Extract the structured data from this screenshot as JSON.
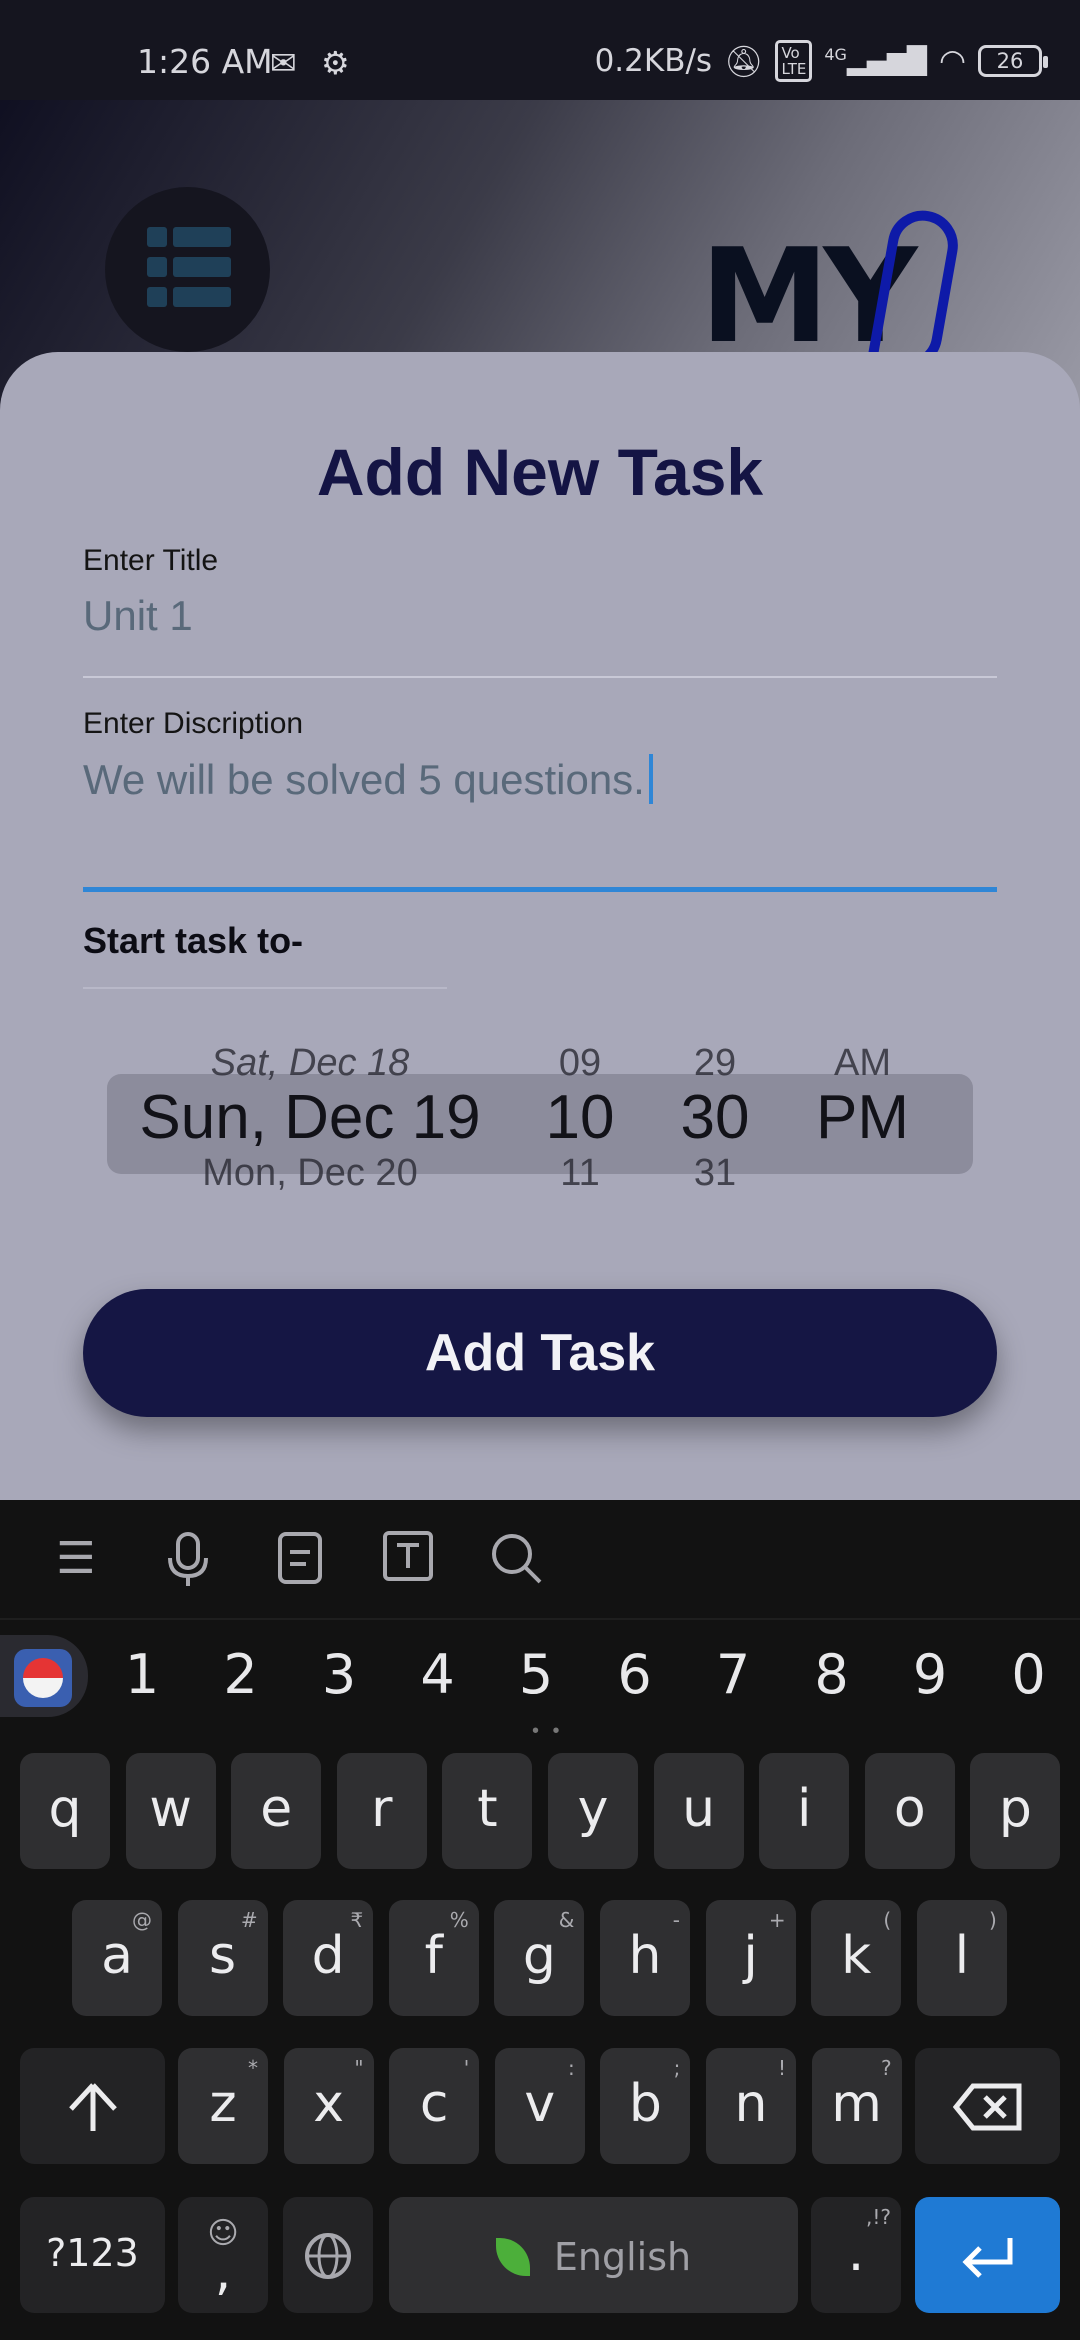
{
  "status_bar": {
    "time": "1:26 AM",
    "left_icons": [
      "gmail-icon",
      "gear-icon"
    ],
    "network_speed": "0.2KB/s",
    "volte_label": "Vo LTE",
    "network_type": "4G",
    "battery": "26"
  },
  "sheet": {
    "title": "Add New Task",
    "title_field": {
      "label": "Enter Title",
      "value": "Unit 1"
    },
    "description_field": {
      "label": "Enter Discription",
      "value": "We will be solved 5 questions."
    },
    "start_label": "Start task to-",
    "picker": {
      "date": {
        "prev": "Sat, Dec 18",
        "selected": "Sun, Dec 19",
        "next": "Mon, Dec 20"
      },
      "hour": {
        "prev": "09",
        "selected": "10",
        "next": "11"
      },
      "minute": {
        "prev": "29",
        "selected": "30",
        "next": "31"
      },
      "ampm": {
        "prev": "AM",
        "selected": "PM"
      }
    },
    "add_button": "Add Task"
  },
  "keyboard": {
    "toolbar": [
      "menu-icon",
      "microphone-icon",
      "clipboard-icon",
      "text-edit-icon",
      "search-icon"
    ],
    "numbers": [
      "1",
      "2",
      "3",
      "4",
      "5",
      "6",
      "7",
      "8",
      "9",
      "0"
    ],
    "row1": [
      "q",
      "w",
      "e",
      "r",
      "t",
      "y",
      "u",
      "i",
      "o",
      "p"
    ],
    "row2": [
      {
        "k": "a",
        "s": "@"
      },
      {
        "k": "s",
        "s": "#"
      },
      {
        "k": "d",
        "s": "₹"
      },
      {
        "k": "f",
        "s": "%"
      },
      {
        "k": "g",
        "s": "&"
      },
      {
        "k": "h",
        "s": "-"
      },
      {
        "k": "j",
        "s": "+"
      },
      {
        "k": "k",
        "s": "("
      },
      {
        "k": "l",
        "s": ")"
      }
    ],
    "row3": [
      {
        "k": "z",
        "s": "*"
      },
      {
        "k": "x",
        "s": "\""
      },
      {
        "k": "c",
        "s": "'"
      },
      {
        "k": "v",
        "s": ":"
      },
      {
        "k": "b",
        "s": ";"
      },
      {
        "k": "n",
        "s": "!"
      },
      {
        "k": "m",
        "s": "?"
      }
    ],
    "symbols_key": "?123",
    "emoji_key": ",",
    "space_label": "English",
    "period_key": ".",
    "period_sub": ",!?",
    "accent_color": "#1f7ad4"
  }
}
